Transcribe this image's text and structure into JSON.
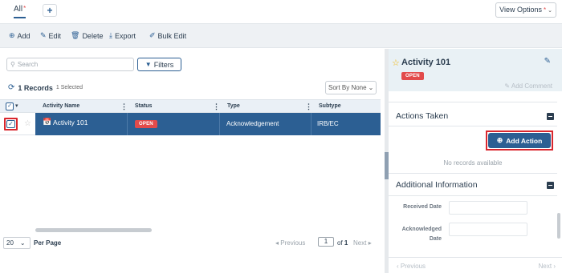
{
  "tabs": {
    "all_label": "All",
    "all_modified": "*",
    "add_tab": "+"
  },
  "view_options": {
    "label": "View Options",
    "modified": "*"
  },
  "toolbar": {
    "add": "Add",
    "edit": "Edit",
    "delete": "Delete",
    "export": "Export",
    "bulk_edit": "Bulk Edit"
  },
  "search": {
    "placeholder": "Search"
  },
  "filters": {
    "label": "Filters"
  },
  "records": {
    "count_text": "1 Records",
    "selected_text": "1 Selected"
  },
  "sort": {
    "label": "Sort By None"
  },
  "grid": {
    "columns": [
      "Activity Name",
      "Status",
      "Type",
      "Subtype"
    ],
    "rows": [
      {
        "activity_name": "Activity 101",
        "status": "OPEN",
        "type": "Acknowledgement",
        "subtype": "IRB/EC",
        "selected": true
      }
    ]
  },
  "pager": {
    "per_page_value": "20",
    "per_page_label": "Per Page",
    "previous": "Previous",
    "page": "1",
    "of_text": "of",
    "total_pages": "1",
    "next": "Next"
  },
  "detail": {
    "title": "Activity 101",
    "status": "OPEN",
    "add_comment": "Add Comment",
    "actions_taken": {
      "title": "Actions Taken",
      "add_action": "Add Action",
      "empty": "No records available"
    },
    "additional_info": {
      "title": "Additional Information",
      "fields": [
        {
          "label": "Received Date",
          "value": ""
        },
        {
          "label": "Acknowledged Date",
          "value": ""
        }
      ]
    },
    "footer": {
      "previous": "Previous",
      "next": "Next"
    }
  },
  "colors": {
    "primary": "#2c5f93",
    "badge_open": "#e24b4b",
    "highlight_outline": "#d9272e",
    "star": "#f1b400"
  }
}
